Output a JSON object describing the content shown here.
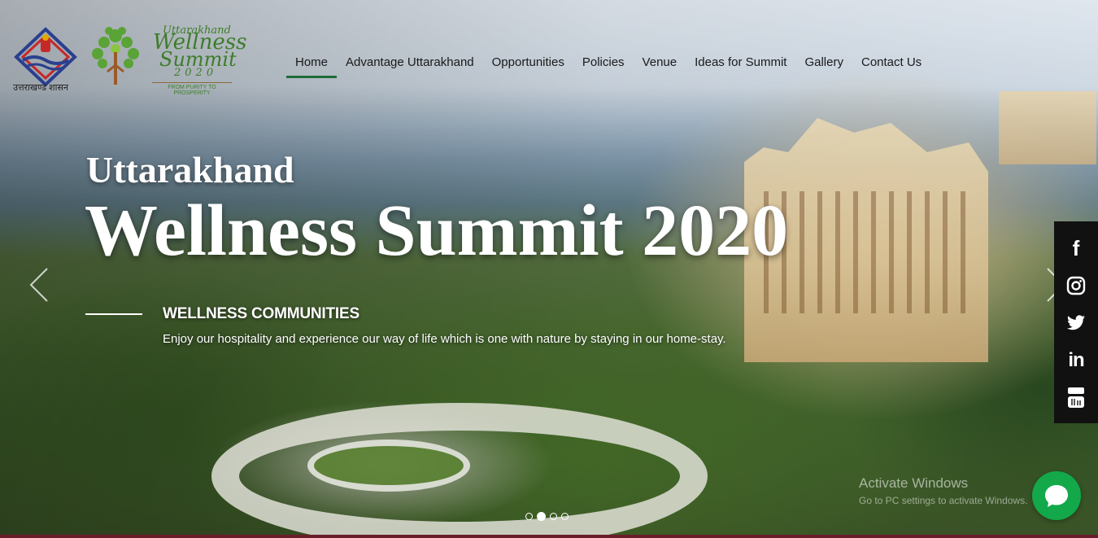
{
  "header": {
    "gov_caption": "उत्तराखण्ड शासन",
    "logo": {
      "line1": "Uttarakhand",
      "line2": "Wellness",
      "line3": "Summit",
      "year": "2020",
      "tagline": "FROM PURITY TO PROSPERITY"
    },
    "nav": [
      {
        "label": "Home",
        "active": true
      },
      {
        "label": "Advantage Uttarakhand"
      },
      {
        "label": "Opportunities"
      },
      {
        "label": "Policies"
      },
      {
        "label": "Venue"
      },
      {
        "label": "Ideas for Summit"
      },
      {
        "label": "Gallery"
      },
      {
        "label": "Contact Us"
      }
    ]
  },
  "hero": {
    "pre_title": "Uttarakhand",
    "title": "Wellness Summit 2020",
    "subtitle": "WELLNESS COMMUNITIES",
    "description": "Enjoy our hospitality and experience our way of life which is one with nature by staying in our home-stay.",
    "slides_count": 4,
    "active_slide": 2
  },
  "social": [
    "facebook-icon",
    "instagram-icon",
    "twitter-icon",
    "linkedin-icon",
    "youtube-icon"
  ],
  "watermark": {
    "line1": "Activate Windows",
    "line2": "Go to PC settings to activate Windows."
  },
  "colors": {
    "nav_active_underline": "#1f6b3a",
    "logo_green": "#3d7d2a",
    "chat_green": "#13a84a",
    "social_bg": "#111111"
  }
}
